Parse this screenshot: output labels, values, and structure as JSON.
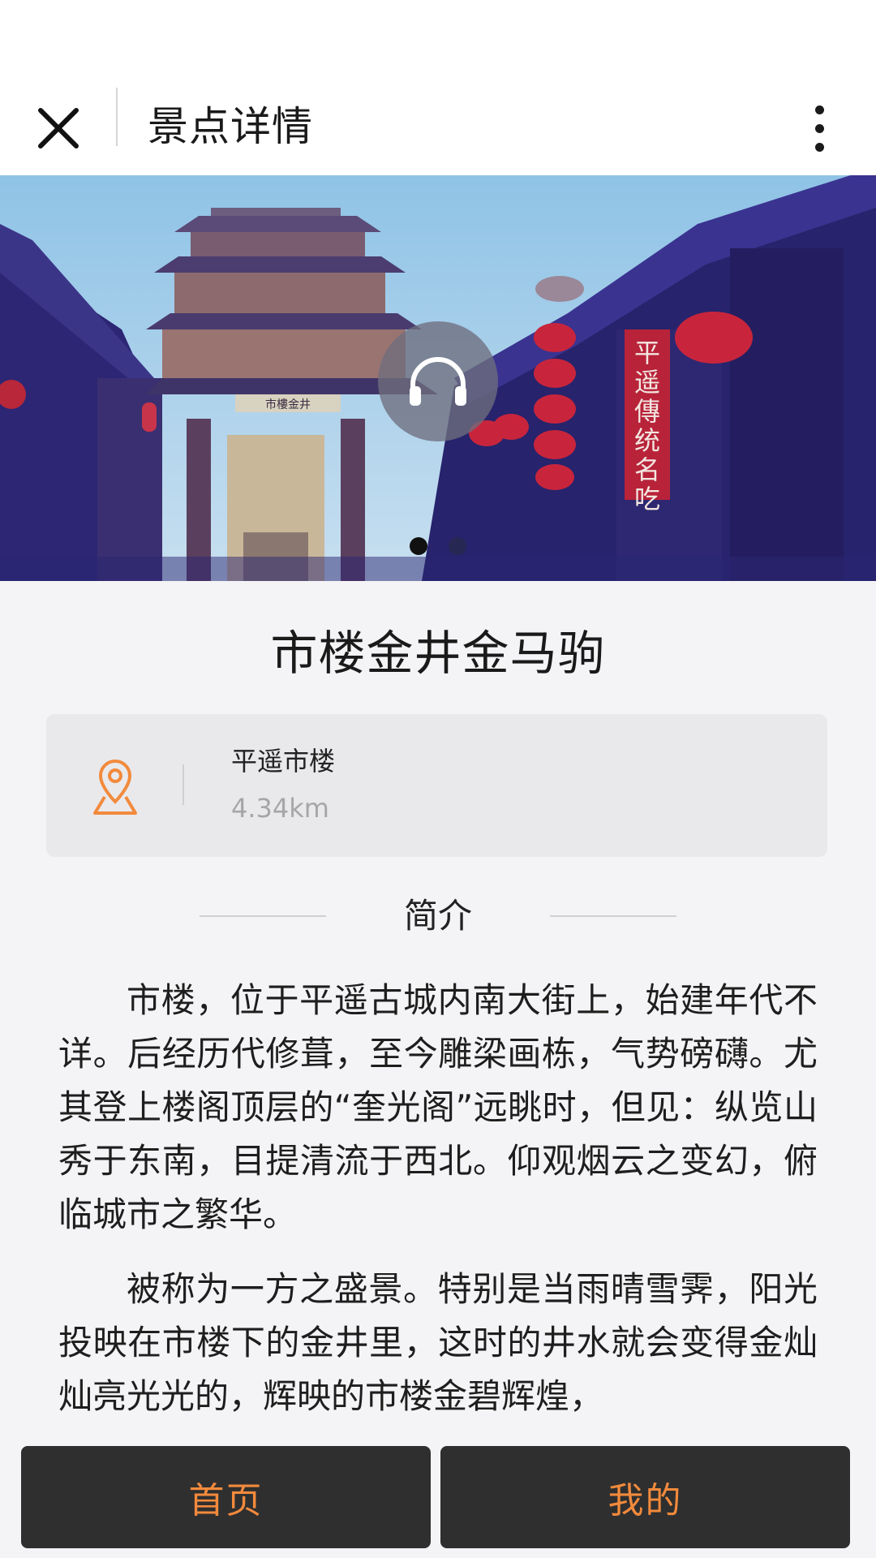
{
  "header": {
    "title": "景点详情"
  },
  "hero": {
    "slide_count": 2,
    "active_slide": 1,
    "sign_text": "平遥傳统名吃",
    "gate_plaque": "市樓金井"
  },
  "spot": {
    "name": "市楼金井金马驹"
  },
  "location": {
    "place": "平遥市楼",
    "distance": "4.34km"
  },
  "intro": {
    "heading": "简介",
    "paragraphs": [
      "市楼，位于平遥古城内南大街上，始建年代不详。后经历代修葺，至今雕梁画栋，气势磅礴。尤其登上楼阁顶层的“奎光阁”远眺时，但见：纵览山秀于东南，目提清流于西北。仰观烟云之变幻，俯临城市之繁华。",
      "被称为一方之盛景。特别是当雨晴雪霁，阳光投映在市楼下的金井里，这时的井水就会变得金灿灿亮光光的，辉映的市楼金碧辉煌，"
    ]
  },
  "bottom_nav": {
    "home": "首页",
    "mine": "我的"
  },
  "colors": {
    "accent": "#f28a3c",
    "button_bg": "#2f2f2f",
    "page_bg": "#f4f4f6"
  }
}
